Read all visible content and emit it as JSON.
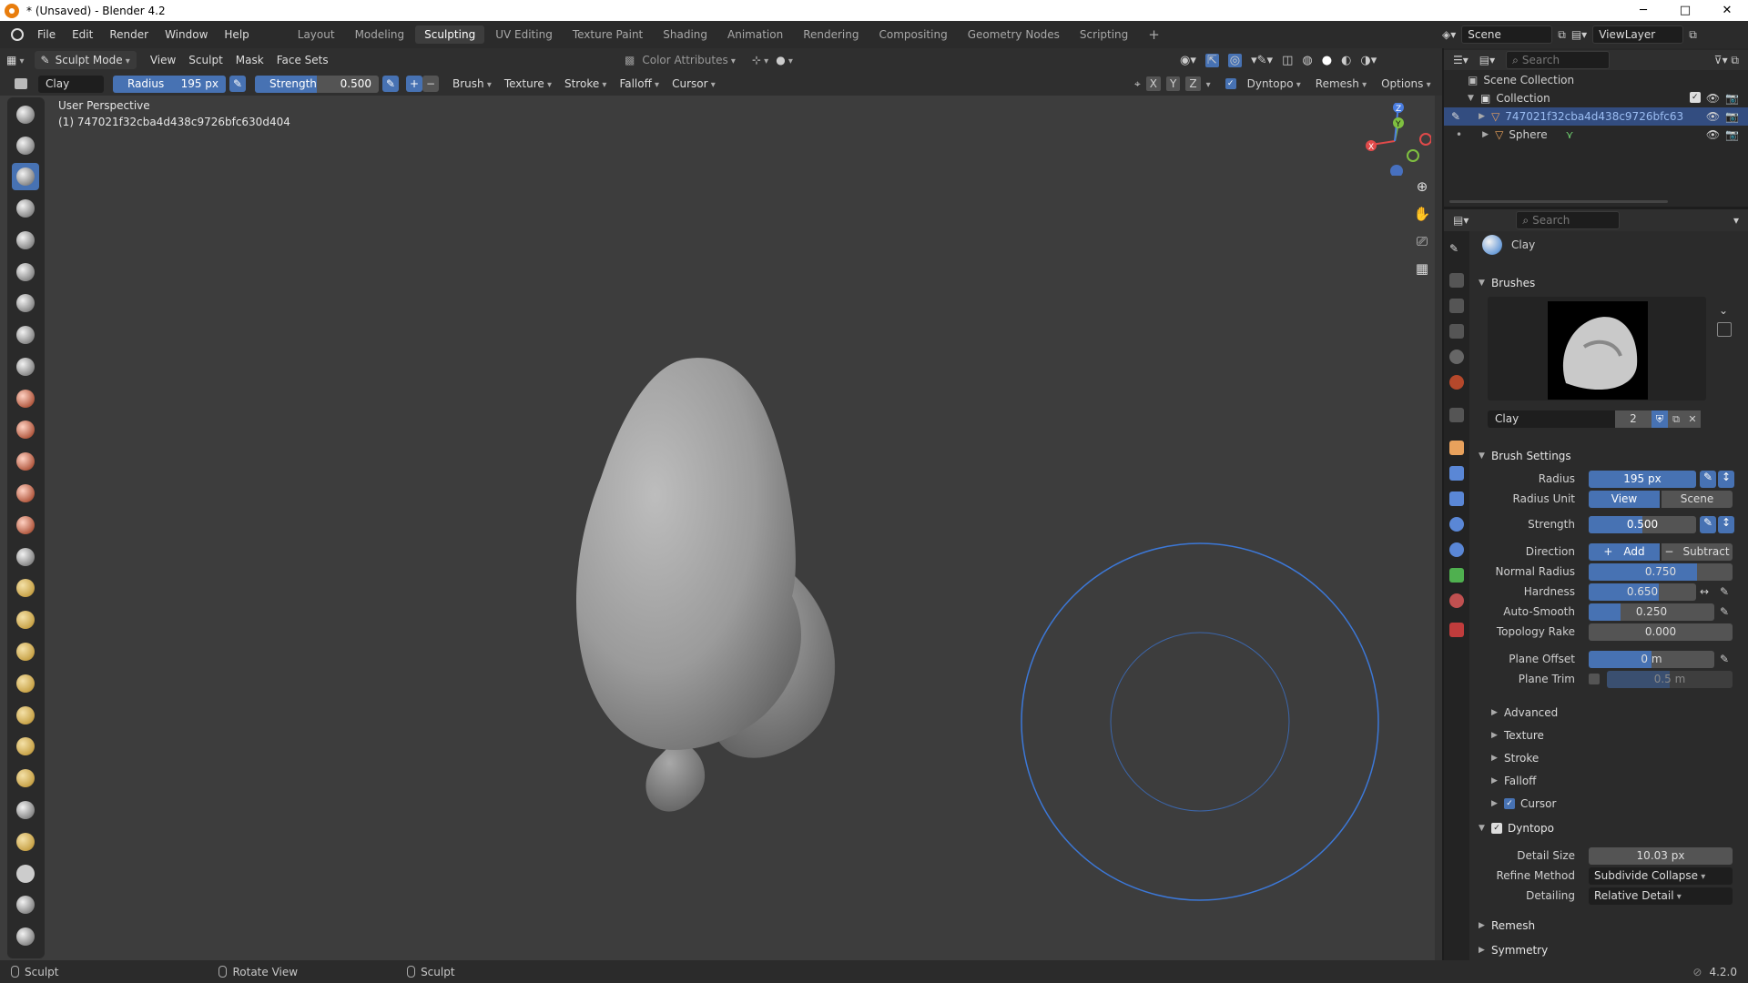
{
  "window": {
    "title": "* (Unsaved) - Blender 4.2",
    "min": "─",
    "max": "□",
    "close": "✕"
  },
  "menus": [
    "File",
    "Edit",
    "Render",
    "Window",
    "Help"
  ],
  "workspaces": [
    "Layout",
    "Modeling",
    "Sculpting",
    "UV Editing",
    "Texture Paint",
    "Shading",
    "Animation",
    "Rendering",
    "Compositing",
    "Geometry Nodes",
    "Scripting"
  ],
  "active_workspace": "Sculpting",
  "scene": {
    "name": "Scene",
    "view_layer": "ViewLayer"
  },
  "header1": {
    "mode": "Sculpt Mode",
    "menus": [
      "View",
      "Sculpt",
      "Mask",
      "Face Sets"
    ],
    "color_attributes": "Color Attributes"
  },
  "header2": {
    "brush_name": "Clay",
    "radius_label": "Radius",
    "radius_value": "195 px",
    "strength_label": "Strength",
    "strength_value": "0.500",
    "plus": "+",
    "minus": "−",
    "dropdowns": [
      "Brush",
      "Texture",
      "Stroke",
      "Falloff",
      "Cursor"
    ],
    "axes": [
      "X",
      "Y",
      "Z"
    ],
    "dyntopo": "Dyntopo",
    "remesh": "Remesh",
    "options": "Options"
  },
  "viewport": {
    "perspective": "User Perspective",
    "object_info": "(1) 747021f32cba4d438c9726bfc630d404",
    "gizmo": {
      "x": "X",
      "y": "Y",
      "z": "Z"
    }
  },
  "outliner": {
    "search_placeholder": "Search",
    "scene_collection": "Scene Collection",
    "collection": "Collection",
    "objects": [
      "747021f32cba4d438c9726bfc63",
      "Sphere"
    ]
  },
  "properties": {
    "search_placeholder": "Search",
    "tool_name": "Clay",
    "brushes_header": "Brushes",
    "brush_name": "Clay",
    "brush_users": "2",
    "brush_settings_header": "Brush Settings",
    "radius_label": "Radius",
    "radius_value": "195 px",
    "radius_unit_label": "Radius Unit",
    "radius_unit_view": "View",
    "radius_unit_scene": "Scene",
    "strength_label": "Strength",
    "strength_value": "0.500",
    "strength_fill": 0.5,
    "direction_label": "Direction",
    "direction_add": "Add",
    "direction_subtract": "Subtract",
    "normal_radius_label": "Normal Radius",
    "normal_radius_value": "0.750",
    "normal_radius_fill": 0.75,
    "hardness_label": "Hardness",
    "hardness_value": "0.650",
    "hardness_fill": 0.65,
    "auto_smooth_label": "Auto-Smooth",
    "auto_smooth_value": "0.250",
    "auto_smooth_fill": 0.25,
    "topology_rake_label": "Topology Rake",
    "topology_rake_value": "0.000",
    "plane_offset_label": "Plane Offset",
    "plane_offset_value": "0 m",
    "plane_trim_label": "Plane Trim",
    "plane_trim_value": "0.5 m",
    "subpanels": [
      "Advanced",
      "Texture",
      "Stroke",
      "Falloff",
      "Cursor"
    ],
    "dyntopo_header": "Dyntopo",
    "detail_size_label": "Detail Size",
    "detail_size_value": "10.03 px",
    "refine_method_label": "Refine Method",
    "refine_method_value": "Subdivide Collapse",
    "detailing_label": "Detailing",
    "detailing_value": "Relative Detail",
    "remesh_header": "Remesh",
    "symmetry_header": "Symmetry"
  },
  "statusbar": {
    "left": "Sculpt",
    "middle": "Rotate View",
    "right": "Sculpt",
    "version": "4.2.0"
  },
  "colors": {
    "accent": "#4772b3",
    "viewport_bg": "#3d3d3d",
    "panel_bg": "#2b2b2b",
    "brush_circle": "#3c78d8"
  }
}
